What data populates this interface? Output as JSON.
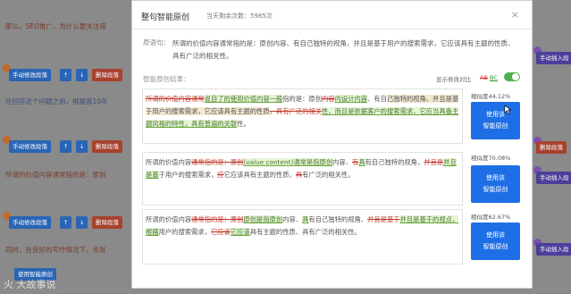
{
  "background": {
    "top_text": "那么，SEO推广，为什么要关注用",
    "row_btns": [
      {
        "manual": "手动修改段落",
        "up": "↑",
        "down": "↓",
        "del": "删除段落"
      }
    ],
    "row2_text": "在回答这个问题之前，根据我10年",
    "row3_text": "所谓的价值内容通常指的是：原创",
    "row4_text": "同时，在良好的写作情况下，也有",
    "right_manual": "手动插入段",
    "right_delete": "删除段落",
    "smart_btn": "使用智能原创"
  },
  "modal": {
    "title": "整句智能原创",
    "count": "当天剩余次数：5985次",
    "close": "×",
    "source_label": "原语句：",
    "source_text": "所谓的价值内容通常指的是：原创内容、有自己独特的视角、并且是基于用户的搜索需求，它应该具有主题的性质、具有广泛的相关性。",
    "result_label": "智能原创结果：",
    "compare_label": "显示修改对比",
    "compare_ab": "AB",
    "compare_bc": "BC",
    "results": [
      {
        "segments": [
          {
            "t": "所谓的价值内容通常",
            "c": "del"
          },
          {
            "t": "说自了的使用价值内容一般",
            "c": "ins"
          },
          {
            "t": "指的是：原创",
            "c": ""
          },
          {
            "t": "内容",
            "c": "del"
          },
          {
            "t": "内设计内容",
            "c": "ins"
          },
          {
            "t": "、有自",
            "c": ""
          },
          {
            "t": "己独特的视角、并且是基于用户的搜索需求，它应该具有主题的性质",
            "c": "hl"
          },
          {
            "t": "，具有广泛的相关",
            "c": "del"
          },
          {
            "t": "性，而且是依据客户的搜索需求，它应当具备主题风格的特性，具有普遍的关联",
            "c": "ins"
          },
          {
            "t": "性。",
            "c": ""
          }
        ],
        "similarity": "相似度44.12%",
        "button": "使用该\n智能原创"
      },
      {
        "segments": [
          {
            "t": "所谓的价值内容",
            "c": ""
          },
          {
            "t": "通常指的是：原创",
            "c": "del"
          },
          {
            "t": "(value content)通常是指原创",
            "c": "ins"
          },
          {
            "t": "内容、",
            "c": ""
          },
          {
            "t": "有",
            "c": "del"
          },
          {
            "t": "具",
            "c": "ins"
          },
          {
            "t": "有自己独特的视角，",
            "c": ""
          },
          {
            "t": "并且是",
            "c": "del"
          },
          {
            "t": "并且是基",
            "c": "ins"
          },
          {
            "t": "于用户的搜索需求，",
            "c": ""
          },
          {
            "t": "应",
            "c": "del"
          },
          {
            "t": "它应该具有主题的性质，",
            "c": ""
          },
          {
            "t": "具",
            "c": "del"
          },
          {
            "t": "有广泛的相关性。",
            "c": ""
          }
        ],
        "similarity": "相似度70.08%",
        "button": "使用该\n智能原创"
      },
      {
        "segments": [
          {
            "t": "所谓的价值内容",
            "c": ""
          },
          {
            "t": "通常指的是：原创",
            "c": "del"
          },
          {
            "t": "原创是指原创",
            "c": "ins"
          },
          {
            "t": "内容、",
            "c": ""
          },
          {
            "t": "具",
            "c": "ins"
          },
          {
            "t": "有自己独特的视角、",
            "c": ""
          },
          {
            "t": "并且是基于",
            "c": "del"
          },
          {
            "t": "并且是基于的视点，根据",
            "c": "ins"
          },
          {
            "t": "用户的搜索需求，",
            "c": ""
          },
          {
            "t": "它应该",
            "c": "del"
          },
          {
            "t": "它应该",
            "c": "ins"
          },
          {
            "t": "具有主题的性质、具有广泛的相关性。",
            "c": ""
          }
        ],
        "similarity": "相似度62.67%",
        "button": "使用该\n智能原创"
      }
    ]
  },
  "watermark": "火 大故事说"
}
